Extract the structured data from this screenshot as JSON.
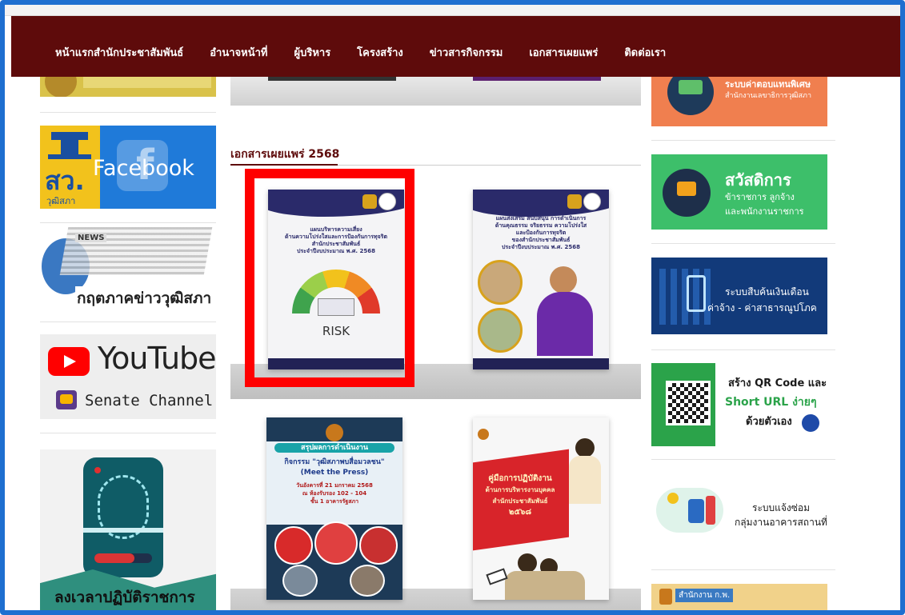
{
  "nav": {
    "items": [
      "หน้าแรกสำนักประชาสัมพันธ์",
      "อำนาจหน้าที่",
      "ผู้บริหาร",
      "โครงสร้าง",
      "ข่าวสารกิจกรรม",
      "เอกสารเผยแพร่",
      "ติดต่อเรา"
    ]
  },
  "left": {
    "facebook_text": "Facebook",
    "facebook_logo": "สว.",
    "facebook_logo_sub": "วุฒิสภา",
    "news_text": "กฤตภาคข่าววุฒิสภา",
    "news_tag": "NEWS",
    "youtube_text": "YouTube",
    "youtube_sub": "Senate Channel",
    "fingerprint_text": "ลงเวลาปฏิบัติราชการ"
  },
  "main": {
    "section_title": "เอกสารเผยแพร่ 2568",
    "books": [
      {
        "title_lines": [
          "แผนบริหารความเสี่ยง",
          "ด้านความโปร่งใสและการป้องกันการทุจริต",
          "สำนักประชาสัมพันธ์",
          "ประจำปีงบประมาณ พ.ศ. 2568"
        ],
        "big_text": "RISK"
      },
      {
        "title_lines": [
          "แผนส่งเสริม สนับสนุน การดำเนินการ",
          "ด้านคุณธรรม จริยธรรม ความโปร่งใส",
          "และป้องกันการทุจริต",
          "ของสำนักประชาสัมพันธ์",
          "ประจำปีงบประมาณ พ.ศ. 2568"
        ]
      },
      {
        "title_lines": [
          "สรุปผลการดำเนินงาน",
          "กิจกรรม \"วุฒิสภาพบสื่อมวลชน\"",
          "(Meet the Press)",
          "วันอังคารที่ 21 มกราคม 2568",
          "ณ ห้องรับรอง 102 - 104",
          "ชั้น 1 อาคารรัฐสภา"
        ]
      },
      {
        "title_lines": [
          "คู่มือการปฏิบัติงาน",
          "ด้านการบริหารงานบุคคล",
          "สำนักประชาสัมพันธ์",
          "๒๕๖๘"
        ]
      }
    ]
  },
  "right": {
    "banner1_line1": "ระบบค่าตอบแทนพิเศษ",
    "banner1_line2": "สำนักงานเลขาธิการวุฒิสภา",
    "banner2_title": "สวัสดิการ",
    "banner2_line1": "ข้าราชการ ลูกจ้าง",
    "banner2_line2": "และพนักงานราชการ",
    "banner3_line1": "ระบบสืบค้นเงินเดือน",
    "banner3_line2": "ค่าจ้าง - ค่าสาธารณูปโภค",
    "banner4_line1": "สร้าง QR Code และ",
    "banner4_line2": "Short URL ง่ายๆ",
    "banner4_line3": "ด้วยตัวเอง",
    "banner5_line1": "ระบบแจ้งซ่อม",
    "banner5_line2": "กลุ่มงานอาคารสถานที่",
    "banner6_text": "สำนักงาน ก.พ."
  },
  "colors": {
    "nav_bg": "#5e0b0b",
    "highlight": "#ff0000",
    "frame": "#1e6fd0"
  }
}
